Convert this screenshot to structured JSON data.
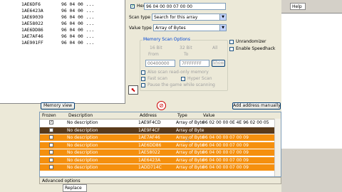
{
  "results": [
    {
      "addr": "1AE6DF6",
      "value": "96 04 00 ..."
    },
    {
      "addr": "1AE6423A",
      "value": "96 04 00 ..."
    },
    {
      "addr": "1AE69039",
      "value": "96 04 00 ..."
    },
    {
      "addr": "1AE58022",
      "value": "96 04 00 ..."
    },
    {
      "addr": "1AE6DD86",
      "value": "96 04 00 ..."
    },
    {
      "addr": "1AE7AF46",
      "value": "96 04 00 ..."
    },
    {
      "addr": "1AE901FF",
      "value": "96 04 00 ..."
    }
  ],
  "scan": {
    "hex_label": "Hex",
    "hex_value": "96 04 00 00 07 00 00",
    "scan_type_label": "Scan type",
    "scan_type_value": "Search for this array",
    "value_type_label": "Value type",
    "value_type_value": "Array of Bytes",
    "memory_options_title": "Memory Scan Options",
    "bits_16": "16 Bit",
    "bits_32": "32 Bit",
    "all": "All",
    "from_label": "From",
    "to_label": "To",
    "from_value": "00400000",
    "to_value": "7FFFFFFF",
    "show_label": "Show",
    "also_scan_readonly": "Also scan read-only memory",
    "fast_scan": "Fast scan",
    "hyper_scan": "Hyper Scan",
    "pause_game": "Pause the game while scanning",
    "unrandomizer": "Unrandomizer",
    "enable_speedhack": "Enable Speedhack"
  },
  "buttons": {
    "memory_view": "Memory view",
    "add_address_manually": "Add address manually",
    "advanced_options": "Advanced options",
    "replace": "Replace"
  },
  "address_list": {
    "columns": {
      "frozen": "Frozen",
      "description": "Description",
      "address": "Address",
      "type": "Type",
      "value": "Value"
    },
    "rows": [
      {
        "frozen": true,
        "description": "No description",
        "address": "1AE9F4CD",
        "type": "Array of Byte",
        "value": "96 02 00 00 0E 4E 96 02 00 05",
        "style": "white"
      },
      {
        "frozen": false,
        "description": "No description",
        "address": "1AE9F4CF",
        "type": "Array of Byte",
        "value": "",
        "style": "selected"
      },
      {
        "frozen": false,
        "description": "No description",
        "address": "1AE7AF46",
        "type": "Array of Byte",
        "value": "96 04 00 00 07 00 09",
        "style": "orange"
      },
      {
        "frozen": false,
        "description": "No description",
        "address": "1AE6DD86",
        "type": "Array of Byte",
        "value": "96 04 00 00 07 00 09",
        "style": "orange"
      },
      {
        "frozen": false,
        "description": "No description",
        "address": "1AE58022",
        "type": "Array of Byte",
        "value": "96 04 00 00 07 00 09",
        "style": "orange"
      },
      {
        "frozen": false,
        "description": "No description",
        "address": "1AE6423A",
        "type": "Array of Byte",
        "value": "96 04 00 00 07 00 09",
        "style": "orange"
      },
      {
        "frozen": false,
        "description": "No description",
        "address": "1ADD714C",
        "type": "Array of Byte",
        "value": "96 04 00 00 07 00 09",
        "style": "orange"
      }
    ]
  },
  "right_panel": {
    "help_label": "Help"
  }
}
